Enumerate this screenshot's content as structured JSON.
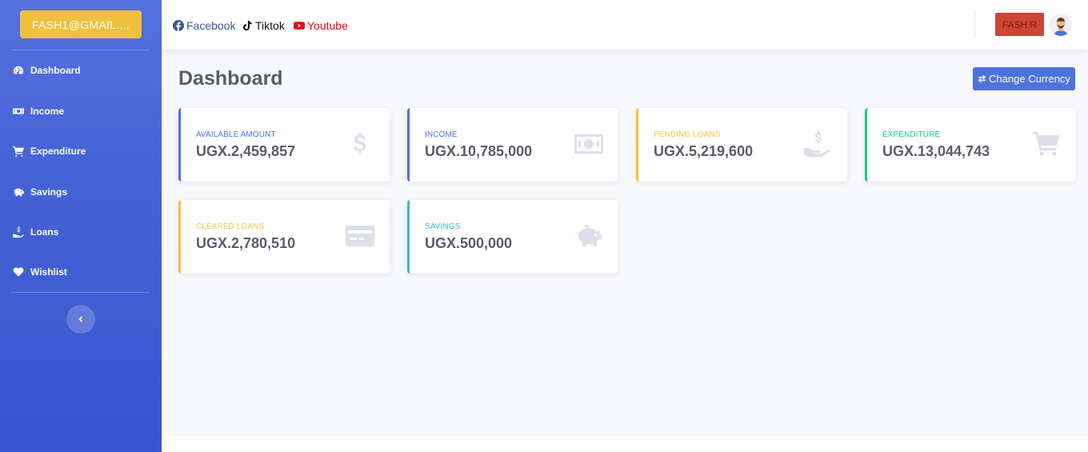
{
  "sidebar": {
    "brand_label": "FASH1@GMAIL....",
    "items": [
      {
        "label": "Dashboard",
        "icon": "tachometer-icon"
      },
      {
        "label": "Income",
        "icon": "money-bill-icon"
      },
      {
        "label": "Expenditure",
        "icon": "shopping-cart-icon"
      },
      {
        "label": "Savings",
        "icon": "piggy-bank-icon"
      },
      {
        "label": "Loans",
        "icon": "hand-holding-usd-icon"
      },
      {
        "label": "Wishlist",
        "icon": "heart-icon"
      }
    ]
  },
  "topbar": {
    "social": [
      {
        "label": "Facebook",
        "color": "#3b5998",
        "icon": "facebook-icon"
      },
      {
        "label": "Tiktok",
        "color": "#000000",
        "icon": "tiktok-icon"
      },
      {
        "label": "Youtube",
        "color": "#e30613",
        "icon": "youtube-icon"
      }
    ],
    "user_label": "FASH R"
  },
  "main": {
    "title": "Dashboard",
    "change_currency_label": "Change Currency",
    "cards": [
      {
        "label": "AVAILABLE AMOUNT",
        "value": "UGX.2,459,857",
        "accent": "#4e73df",
        "icon": "dollar-icon"
      },
      {
        "label": "INCOME",
        "value": "UGX.10,785,000",
        "accent": "#4e73df",
        "icon": "money-bill-icon"
      },
      {
        "label": "PENDING LOANS",
        "value": "UGX.5,219,600",
        "accent": "#f6c23e",
        "icon": "hand-holding-usd-icon"
      },
      {
        "label": "EXPENDITURE",
        "value": "UGX.13,044,743",
        "accent": "#1cc88a",
        "icon": "shopping-cart-icon"
      },
      {
        "label": "CLEARED LOANS",
        "value": "UGX.2,780,510",
        "accent": "#f6c23e",
        "icon": "credit-card-icon"
      },
      {
        "label": "SAVINGS",
        "value": "UGX.500,000",
        "accent": "#36b9cc",
        "icon": "piggy-bank-icon"
      }
    ]
  }
}
